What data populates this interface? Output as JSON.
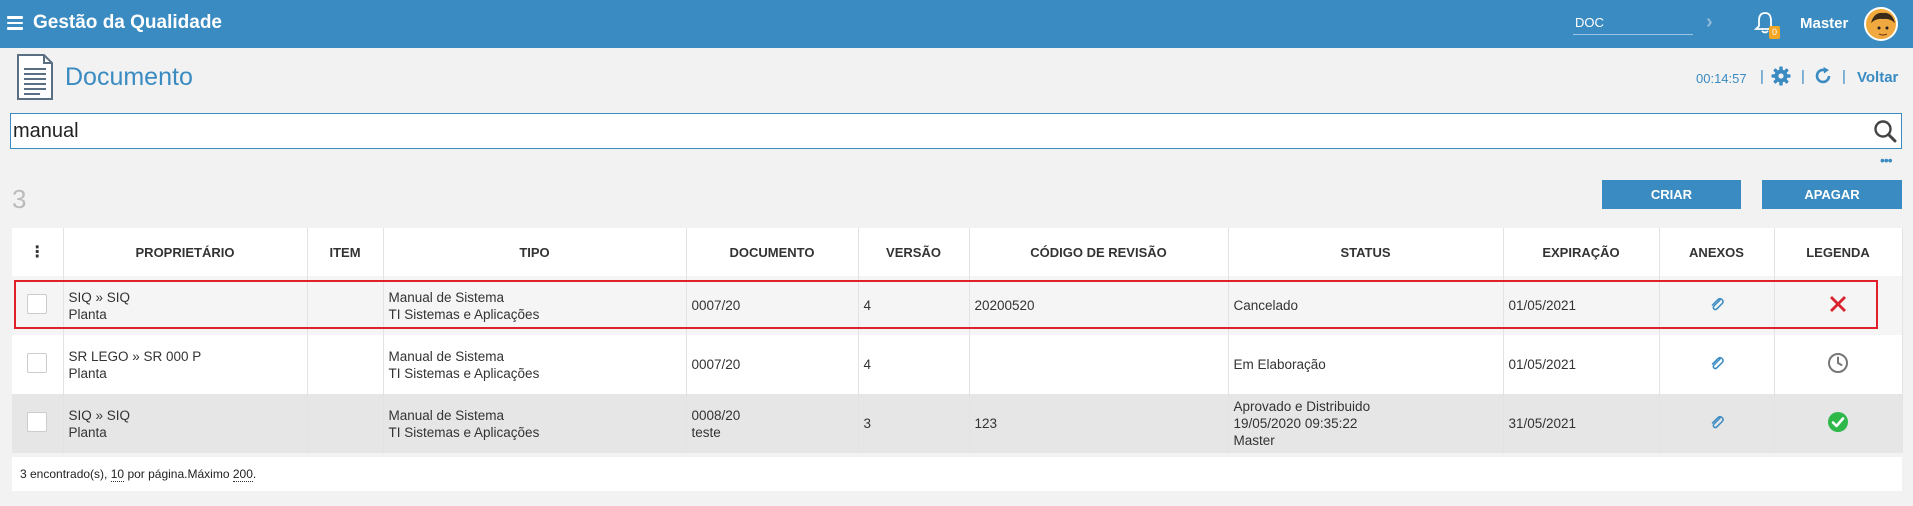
{
  "topbar": {
    "app_title": "Gestão da Qualidade",
    "doc_search_value": "DOC",
    "notification_count": "0",
    "user_name": "Master"
  },
  "header": {
    "page_title": "Documento",
    "timer": "00:14:57",
    "back_label": "Voltar"
  },
  "search": {
    "value": "manual"
  },
  "results": {
    "count": "3",
    "create_label": "CRIAR",
    "delete_label": "APAGAR"
  },
  "table": {
    "columns": [
      "PROPRIETÁRIO",
      "ITEM",
      "TIPO",
      "DOCUMENTO",
      "VERSÃO",
      "CÓDIGO DE REVISÃO",
      "STATUS",
      "EXPIRAÇÃO",
      "ANEXOS",
      "LEGENDA"
    ],
    "rows": [
      {
        "owner_line1": "SIQ » SIQ",
        "owner_line2": "Planta",
        "item": "",
        "type_line1": "Manual de Sistema",
        "type_line2": "TI Sistemas e Aplicações",
        "document_line1": "0007/20",
        "document_line2": "",
        "version": "4",
        "revision_code": "20200520",
        "status_line1": "Cancelado",
        "status_line2": "",
        "status_line3": "",
        "expiration": "01/05/2021",
        "legend": "cancel-x-icon"
      },
      {
        "owner_line1": "SR LEGO » SR 000 P",
        "owner_line2": "Planta",
        "item": "",
        "type_line1": "Manual de Sistema",
        "type_line2": "TI Sistemas e Aplicações",
        "document_line1": "0007/20",
        "document_line2": "",
        "version": "4",
        "revision_code": "",
        "status_line1": "Em Elaboração",
        "status_line2": "",
        "status_line3": "",
        "expiration": "01/05/2021",
        "legend": "clock-icon"
      },
      {
        "owner_line1": "SIQ » SIQ",
        "owner_line2": "Planta",
        "item": "",
        "type_line1": "Manual de Sistema",
        "type_line2": "TI Sistemas e Aplicações",
        "document_line1": "0008/20",
        "document_line2": "teste",
        "version": "3",
        "revision_code": "123",
        "status_line1": "Aprovado e Distribuido",
        "status_line2": "19/05/2020 09:35:22",
        "status_line3": "Master",
        "expiration": "31/05/2021",
        "legend": "check-icon"
      }
    ]
  },
  "footer": {
    "found": "3 encontrado(s),",
    "per_page": "10",
    "per_page_suffix": "por página.Máximo",
    "max": "200",
    "end": "."
  },
  "colors": {
    "brand": "#3a8bc2",
    "highlight": "#e0202a",
    "cancel": "#d9232d",
    "approved": "#2eb84a",
    "clock": "#777777"
  }
}
